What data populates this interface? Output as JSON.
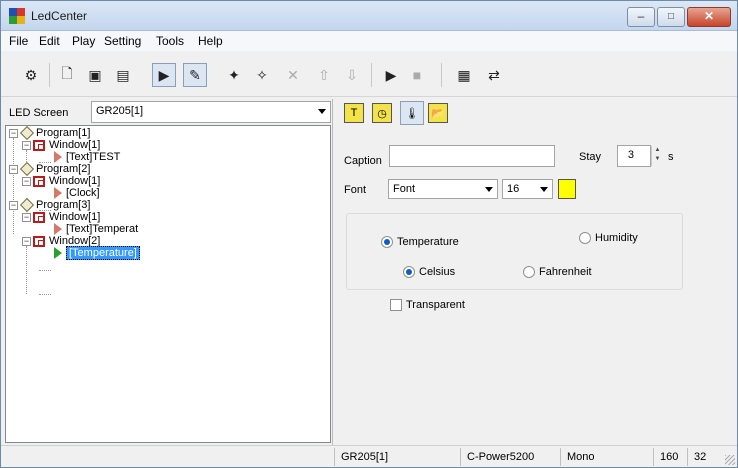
{
  "window": {
    "title": "LedCenter",
    "minimize": "–",
    "maximize": "□",
    "close": "✕"
  },
  "menu": [
    "File",
    "Edit",
    "Play",
    "Setting",
    "Tools",
    "Help"
  ],
  "toolbar": {
    "icons": [
      "settings-icon",
      "new-icon",
      "open-icon",
      "save-icon",
      "preview-icon",
      "edit-icon",
      "add-program-icon",
      "add-window-icon",
      "delete-icon",
      "move-up-icon",
      "move-down-icon",
      "play-icon",
      "stop-icon",
      "send-icon",
      "connect-icon"
    ]
  },
  "left": {
    "led_screen_label": "LED Screen",
    "led_screen_value": "GR205[1]",
    "tree": [
      {
        "label": "Program[1]",
        "type": "program"
      },
      {
        "label": "Window[1]",
        "type": "window"
      },
      {
        "label": "[Text]TEST",
        "type": "item"
      },
      {
        "label": "Program[2]",
        "type": "program"
      },
      {
        "label": "Window[1]",
        "type": "window"
      },
      {
        "label": "[Clock]",
        "type": "item"
      },
      {
        "label": "Program[3]",
        "type": "program"
      },
      {
        "label": "Window[1]",
        "type": "window"
      },
      {
        "label": "[Text]Temperat",
        "type": "item"
      },
      {
        "label": "Window[2]",
        "type": "window"
      },
      {
        "label": "[Temperature]",
        "type": "item",
        "selected": true
      }
    ]
  },
  "right": {
    "tabs": [
      "text-tab-icon",
      "clock-tab-icon",
      "temperature-tab-icon",
      "open-folder-icon"
    ],
    "caption_label": "Caption",
    "caption_value": "",
    "stay_label": "Stay",
    "stay_value": "3",
    "stay_unit": "s",
    "font_label": "Font",
    "font_value": "Font",
    "size_value": "16",
    "color": "#ffff00",
    "temperature_label": "Temperature",
    "humidity_label": "Humidity",
    "celsius_label": "Celsius",
    "fahrenheit_label": "Fahrenheit",
    "transparent_label": "Transparent"
  },
  "status": {
    "screen": "GR205[1]",
    "controller": "C-Power5200",
    "color_mode": "Mono",
    "width": "160",
    "height": "32"
  }
}
